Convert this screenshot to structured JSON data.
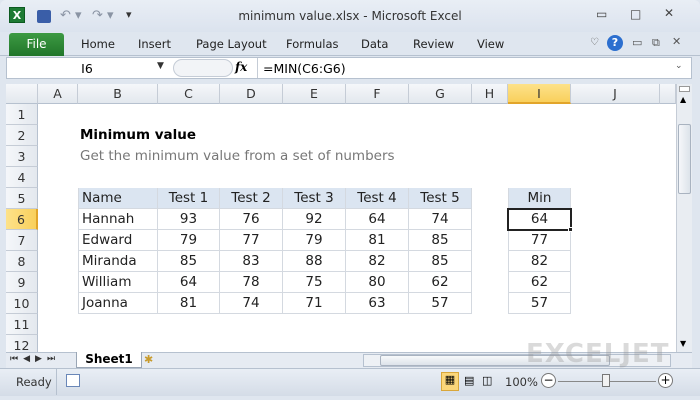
{
  "window": {
    "title": "minimum value.xlsx  -  Microsoft Excel"
  },
  "ribbon": {
    "tabs": [
      "File",
      "Home",
      "Insert",
      "Page Layout",
      "Formulas",
      "Data",
      "Review",
      "View"
    ]
  },
  "formula_bar": {
    "name_box": "I6",
    "fx": "fx",
    "formula": "=MIN(C6:G6)"
  },
  "columns": [
    "A",
    "B",
    "C",
    "D",
    "E",
    "F",
    "G",
    "H",
    "I",
    "J"
  ],
  "rows": [
    "1",
    "2",
    "3",
    "4",
    "5",
    "6",
    "7",
    "8",
    "9",
    "10",
    "11",
    "12"
  ],
  "sheet": {
    "title": "Minimum value",
    "subtitle": "Get the minimum value from a set of numbers",
    "headers": [
      "Name",
      "Test 1",
      "Test 2",
      "Test 3",
      "Test 4",
      "Test 5"
    ],
    "data": [
      [
        "Hannah",
        "93",
        "76",
        "92",
        "64",
        "74"
      ],
      [
        "Edward",
        "79",
        "77",
        "79",
        "81",
        "85"
      ],
      [
        "Miranda",
        "85",
        "83",
        "88",
        "82",
        "85"
      ],
      [
        "William",
        "64",
        "78",
        "75",
        "80",
        "62"
      ],
      [
        "Joanna",
        "81",
        "74",
        "71",
        "63",
        "57"
      ]
    ],
    "min_header": "Min",
    "min_values": [
      "64",
      "77",
      "82",
      "62",
      "57"
    ]
  },
  "sheet_tabs": [
    "Sheet1"
  ],
  "status": {
    "ready": "Ready",
    "zoom": "100%"
  },
  "watermark": "EXCELJET"
}
